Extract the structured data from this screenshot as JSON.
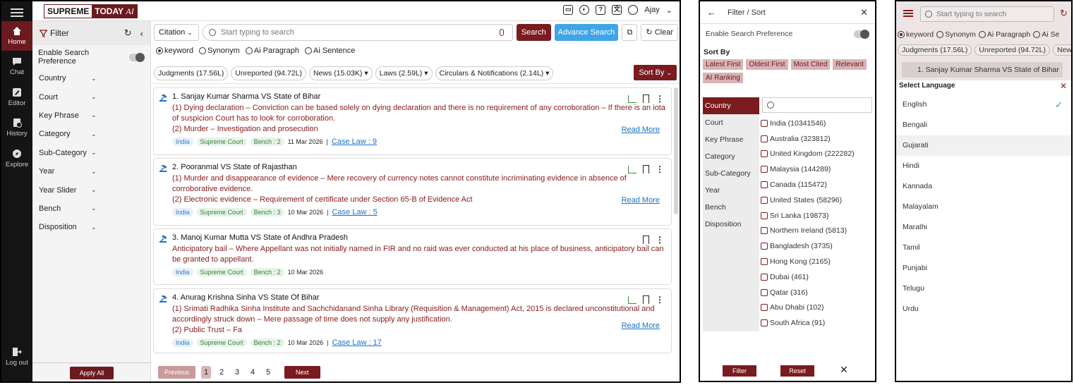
{
  "p1": {
    "logo": {
      "part1": "SUPREME",
      "part2": "TODAY",
      "part3": "AI"
    },
    "rail": [
      {
        "label": "Home",
        "icon": "home-icon"
      },
      {
        "label": "Chat",
        "icon": "chat-icon"
      },
      {
        "label": "Editor",
        "icon": "editor-icon"
      },
      {
        "label": "History",
        "icon": "history-icon"
      },
      {
        "label": "Explore",
        "icon": "explore-icon"
      }
    ],
    "logout": "Log out",
    "user": "Ajay",
    "filter": {
      "title": "Filter",
      "pref": "Enable Search Preference",
      "items": [
        "Country",
        "Court",
        "Key Phrase",
        "Category",
        "Sub-Category",
        "Year",
        "Year Slider",
        "Bench",
        "Disposition"
      ],
      "apply": "Apply All"
    },
    "search": {
      "citation": "Citation",
      "placeholder": "Start typing to search",
      "search_btn": "Search",
      "advance_btn": "Advance Search",
      "clear_btn": "Clear"
    },
    "radios": [
      "keyword",
      "Synonym",
      "Ai Paragraph",
      "Ai Sentence"
    ],
    "tabs": [
      "Judgments (17.56L)",
      "Unreported (94.72L)",
      "News (15.03K)",
      "Laws (2.59L)",
      "Circulars & Notifications (2.14L)"
    ],
    "sort_by": "Sort By",
    "results": [
      {
        "title": "1. Sanjay Kumar Sharma VS State of Bihar",
        "lines": [
          "(1) Dying declaration – Conviction can be based solely on dying declaration and there is no requirement of any corroboration – If there is an iota of suspicion Court has to look for corroboration.",
          "(2) Murder – Investigation and prosecution"
        ],
        "country": "India",
        "court": "Supreme Court",
        "bench": "Bench : 2",
        "date": "11 Mar 2026",
        "caselaw": "Case Law : 9",
        "readmore": "Read More"
      },
      {
        "title": "2. Pooranmal VS State of Rajasthan",
        "lines": [
          "(1) Murder and disappearance of evidence – Mere recovery of currency notes cannot constitute incriminating evidence in absence of corroborative evidence.",
          "(2) Electronic evidence – Requirement of certificate under Section 65-B of Evidence Act"
        ],
        "country": "India",
        "court": "Supreme Court",
        "bench": "Bench : 3",
        "date": "10 Mar 2026",
        "caselaw": "Case Law : 5",
        "readmore": "Read More"
      },
      {
        "title": "3. Manoj Kumar Mutta VS State of Andhra Pradesh",
        "lines": [
          "Anticipatory bail – Where Appellant was not initially named in FIR and no raid was ever conducted at his place of business, anticipatory bail can be granted to appellant."
        ],
        "country": "India",
        "court": "Supreme Court",
        "bench": "Bench : 2",
        "date": "10 Mar 2026"
      },
      {
        "title": "4. Anurag Krishna Sinha VS State Of Bihar",
        "lines": [
          "(1) Srimati Radhika Sinha Institute and Sachchidanand Sinha Library (Requisition & Management) Act, 2015 is declared unconstitutional and accordingly struck down – Mere passage of time does not supply any justification.",
          "(2) Public Trust – Fa"
        ],
        "country": "India",
        "court": "Supreme Court",
        "bench": "Bench : 2",
        "date": "10 Mar 2026",
        "caselaw": "Case Law : 17",
        "readmore": "Read More"
      }
    ],
    "pager": {
      "prev": "Previous",
      "pages": [
        "1",
        "2",
        "3",
        "4",
        "5"
      ],
      "next": "Next"
    }
  },
  "p2": {
    "title": "Filter / Sort",
    "pref": "Enable Search Preference",
    "sort_label": "Sort By",
    "sort_options": [
      "Latest First",
      "Oldest First",
      "Most Cited",
      "Relevant",
      "AI Ranking"
    ],
    "categories": [
      "Country",
      "Court",
      "Key Phrase",
      "Category",
      "Sub-Category",
      "Year",
      "Bench",
      "Disposition"
    ],
    "countries": [
      "India (10341546)",
      "Australia (323812)",
      "United Kingdom (222282)",
      "Malaysia (144289)",
      "Canada (115472)",
      "United States (58296)",
      "Sri Lanka (19873)",
      "Northern Ireland (5813)",
      "Bangladesh (3735)",
      "Hong Kong (2165)",
      "Dubai (461)",
      "Qatar (316)",
      "Abu Dhabi (102)",
      "South Africa (91)"
    ],
    "filter_btn": "Filter",
    "reset_btn": "Reset"
  },
  "p3": {
    "placeholder": "Start typing to search",
    "radios": [
      "keyword",
      "Synonym",
      "Ai Paragraph",
      "Ai Se"
    ],
    "tabs": [
      "Judgments (17.56L)",
      "Unreported (94.72L)",
      "New"
    ],
    "result": "1. Sanjay Kumar Sharma VS State of Bihar",
    "lang_title": "Select Language",
    "languages": [
      "English",
      "Bengali",
      "Gujarati",
      "Hindi",
      "Kannada",
      "Malayalam",
      "Marathi",
      "Tamil",
      "Punjabi",
      "Telugu",
      "Urdu"
    ]
  },
  "colors": {
    "brand": "#7a1b20",
    "accent_blue": "#3fa5e8",
    "link": "#1a73c8",
    "highlight": "#8a1a1a"
  }
}
